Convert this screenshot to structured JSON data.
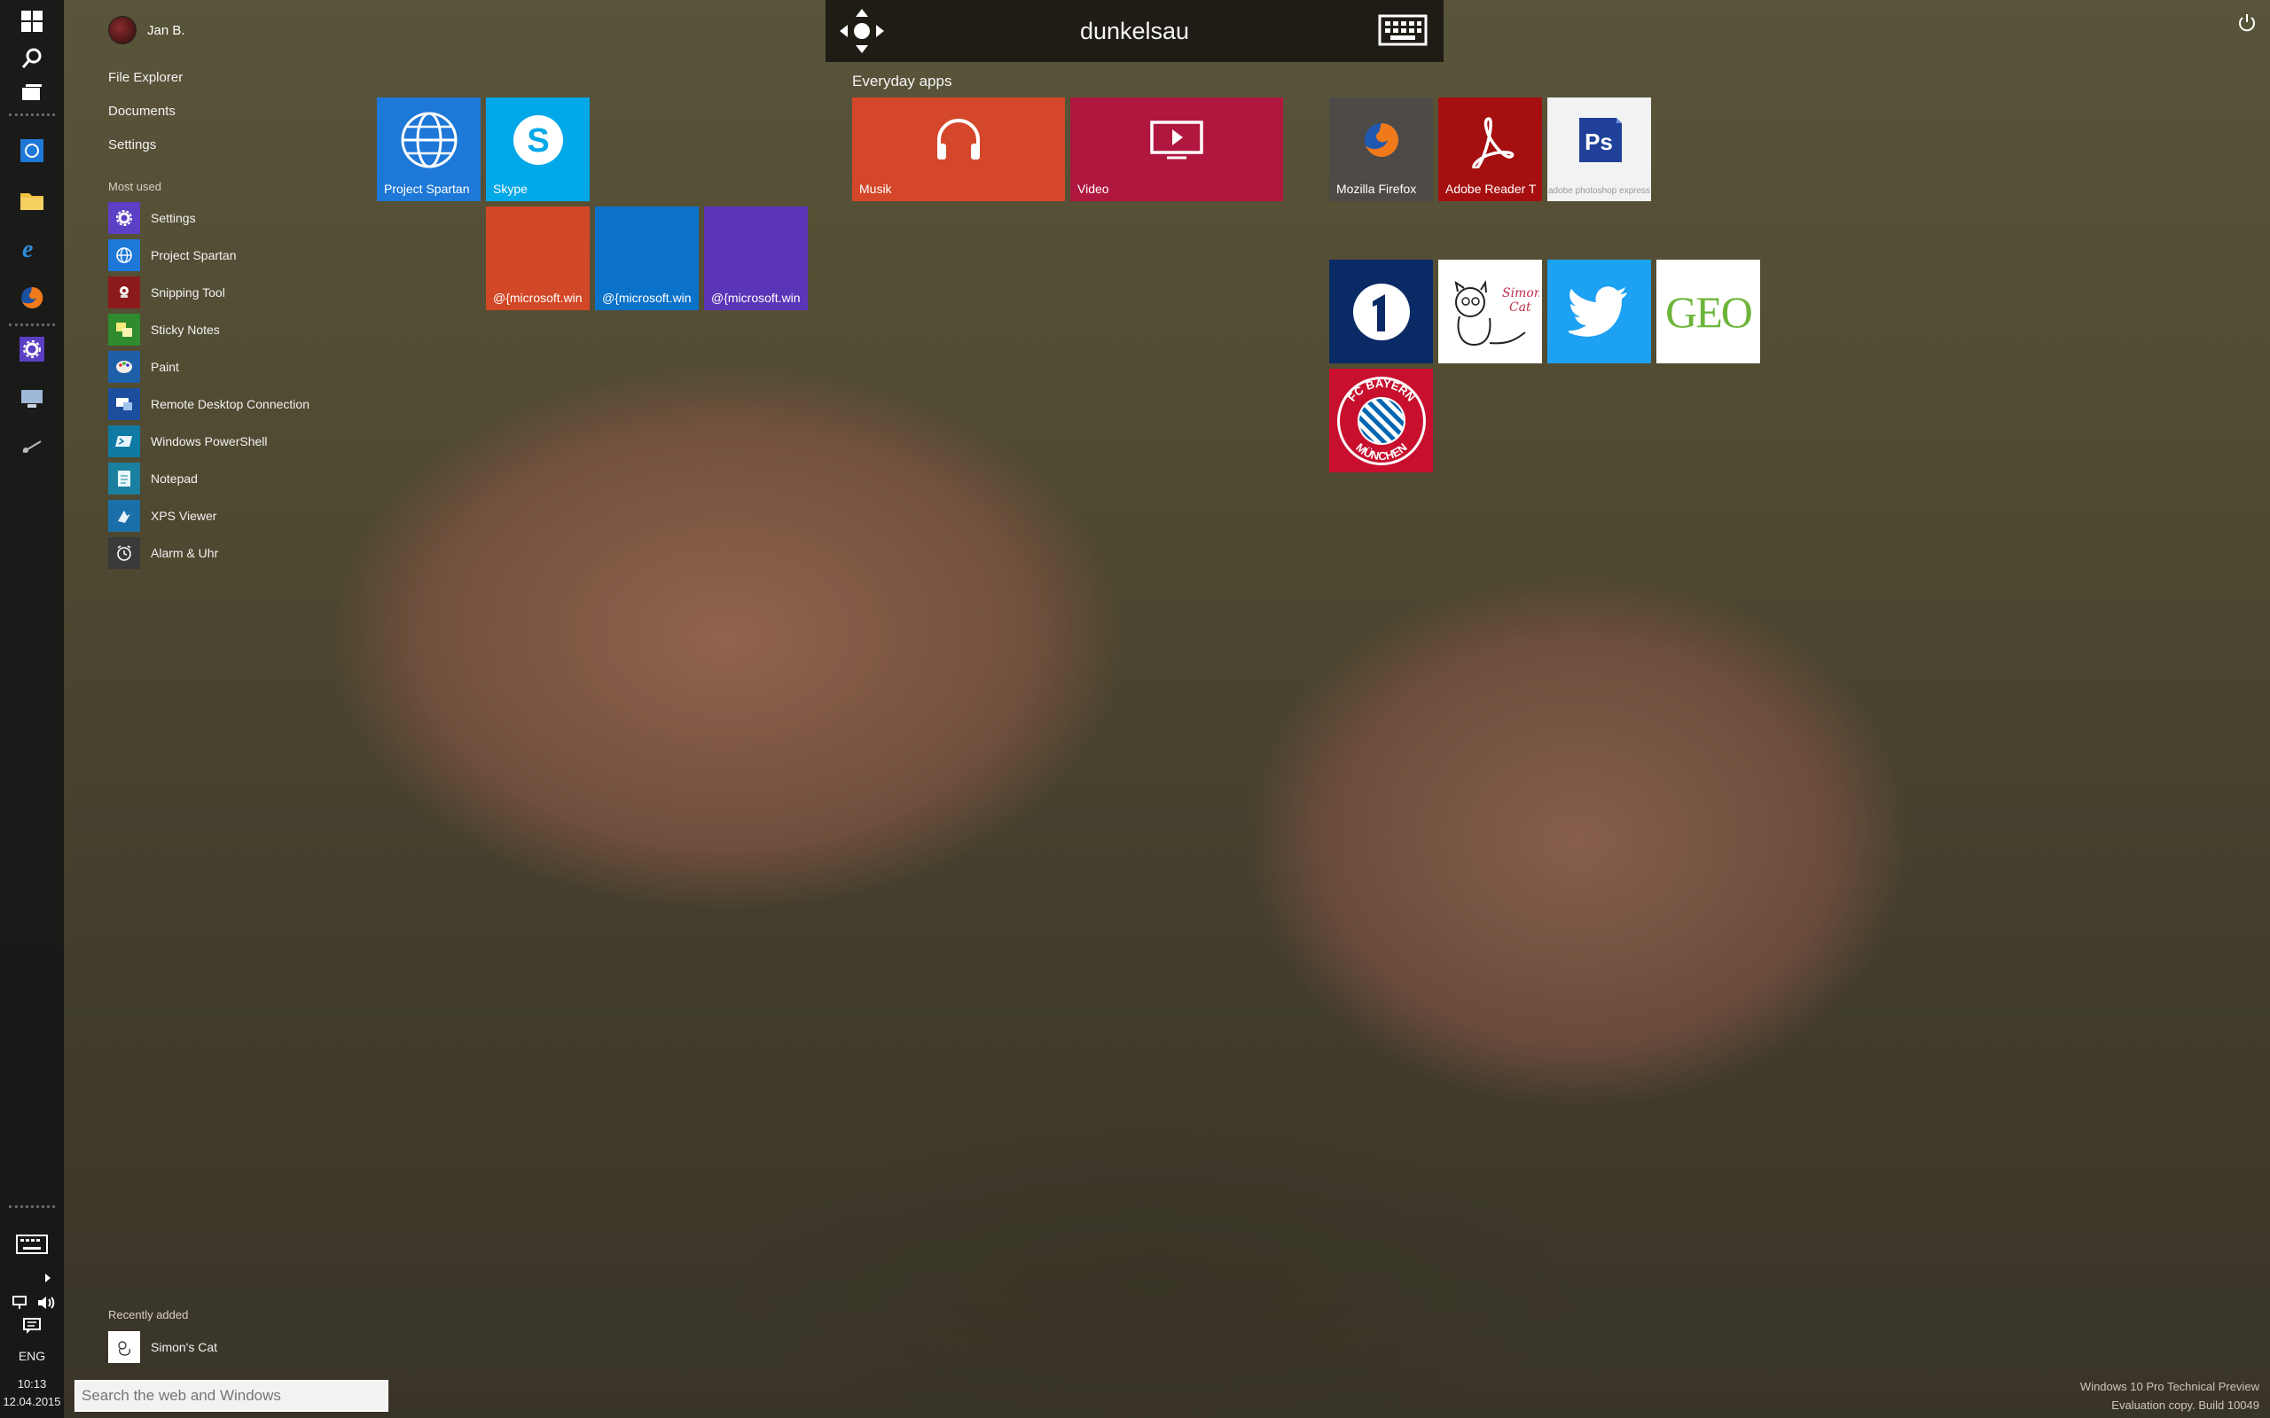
{
  "top_bar": {
    "title": "dunkelsau",
    "move_icon": "move-arrows-icon",
    "keyboard_icon": "keyboard-icon"
  },
  "user": {
    "name": "Jan B."
  },
  "links": [
    "File Explorer",
    "Documents",
    "Settings"
  ],
  "most_used": {
    "title": "Most used",
    "items": [
      {
        "label": "Settings",
        "icon": "gear-icon",
        "color": "#5b3fc4"
      },
      {
        "label": "Project Spartan",
        "icon": "globe-icon",
        "color": "#1e78d7"
      },
      {
        "label": "Snipping Tool",
        "icon": "scissors-icon",
        "color": "#8b1a1a"
      },
      {
        "label": "Sticky Notes",
        "icon": "sticky-note-icon",
        "color": "#2e8b2e"
      },
      {
        "label": "Paint",
        "icon": "palette-icon",
        "color": "#1d5fa8"
      },
      {
        "label": "Remote Desktop Connection",
        "icon": "remote-desktop-icon",
        "color": "#1b4e9c"
      },
      {
        "label": "Windows PowerShell",
        "icon": "powershell-icon",
        "color": "#0f7aa3"
      },
      {
        "label": "Notepad",
        "icon": "notepad-icon",
        "color": "#1b7fa0"
      },
      {
        "label": "XPS Viewer",
        "icon": "xps-viewer-icon",
        "color": "#1a6fa8"
      },
      {
        "label": "Alarm & Uhr",
        "icon": "alarm-clock-icon",
        "color": "#3a3a3a"
      }
    ]
  },
  "recently_added": {
    "title": "Recently added",
    "items": [
      {
        "label": "Simon's Cat",
        "icon": "simons-cat-icon"
      }
    ]
  },
  "search": {
    "placeholder": "Search the web and Windows"
  },
  "tiles": {
    "group1": [
      {
        "label": "Project Spartan",
        "icon": "globe-icon",
        "color": "#1e78d7"
      },
      {
        "label": "Skype",
        "icon": "skype-icon",
        "color": "#00a8e8"
      },
      {
        "label": "@{microsoft.win",
        "icon": "",
        "color": "#d24726"
      },
      {
        "label": "@{microsoft.win",
        "icon": "",
        "color": "#0b72c9"
      },
      {
        "label": "@{microsoft.win",
        "icon": "",
        "color": "#5a35b8"
      }
    ],
    "everyday": {
      "title": "Everyday apps",
      "items": [
        {
          "label": "Musik",
          "icon": "headphones-icon",
          "color": "#d4472a"
        },
        {
          "label": "Video",
          "icon": "video-icon",
          "color": "#b0173e"
        }
      ]
    },
    "group3": [
      {
        "label": "Mozilla Firefox",
        "icon": "firefox-icon",
        "color": "#4d4a48"
      },
      {
        "label": "Adobe Reader T",
        "icon": "acrobat-icon",
        "color": "#a50f0f"
      },
      {
        "label": "",
        "icon": "photoshop-express-icon",
        "color": "#f2f2f2",
        "sublabel": "adobe photoshop express"
      },
      {
        "label": "",
        "icon": "ard-das-erste-icon",
        "color": "#0a2a66"
      },
      {
        "label": "",
        "icon": "simons-cat-icon",
        "color": "#ffffff"
      },
      {
        "label": "",
        "icon": "twitter-icon",
        "color": "#1da1f2"
      },
      {
        "label": "",
        "icon": "geo-icon",
        "color": "#ffffff",
        "text": "GEO"
      },
      {
        "label": "",
        "icon": "fc-bayern-icon",
        "color": "#c8102e",
        "text": "FC BAYERN MÜNCHEN"
      }
    ]
  },
  "system": {
    "language": "ENG",
    "time": "10:13",
    "date": "12.04.2015"
  },
  "watermark": {
    "line1": "Windows 10 Pro Technical Preview",
    "line2": "Evaluation copy. Build 10049"
  }
}
